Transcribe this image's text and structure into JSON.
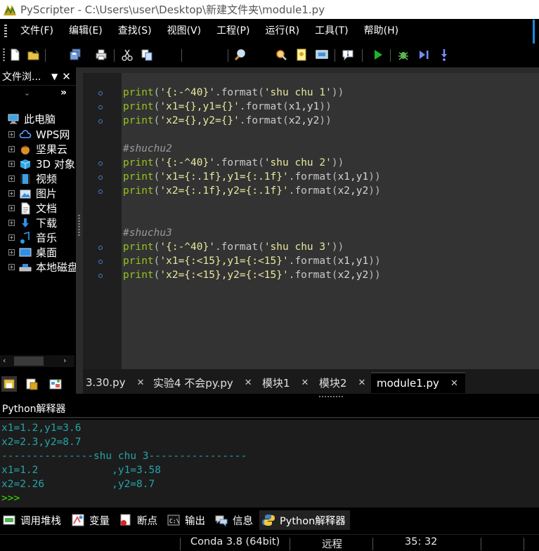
{
  "window": {
    "title": "PyScripter - C:\\Users\\user\\Desktop\\新建文件夹\\module1.py"
  },
  "menu": [
    "文件(F)",
    "编辑(E)",
    "查找(S)",
    "视图(V)",
    "工程(P)",
    "运行(R)",
    "工具(T)",
    "帮助(H)"
  ],
  "toolbar": {
    "icons": [
      "new-file-icon",
      "open-file-icon",
      "save-all-icon",
      "print-icon",
      "cut-icon",
      "copy-icon",
      "find-icon",
      "find-in-files-icon",
      "bookmark-icon",
      "screen-icon",
      "info-icon",
      "run-icon",
      "debug-icon",
      "step-icon",
      "step-into-icon"
    ]
  },
  "file_browser": {
    "title": "文件浏...",
    "pin": "▼",
    "close": "✕",
    "root": "此电脑",
    "items": [
      {
        "label": "WPS网",
        "icon": "cloud-icon"
      },
      {
        "label": "坚果云",
        "icon": "nut-icon"
      },
      {
        "label": "3D 对象",
        "icon": "cube-icon"
      },
      {
        "label": "视频",
        "icon": "film-icon"
      },
      {
        "label": "图片",
        "icon": "image-icon"
      },
      {
        "label": "文档",
        "icon": "document-icon"
      },
      {
        "label": "下载",
        "icon": "download-icon"
      },
      {
        "label": "音乐",
        "icon": "music-icon"
      },
      {
        "label": "桌面",
        "icon": "desktop-icon"
      },
      {
        "label": "本地磁盘",
        "icon": "drive-icon"
      }
    ]
  },
  "editor": {
    "lines": [
      {
        "bullet": true,
        "tokens": [
          [
            "fn",
            "print"
          ],
          [
            "punc",
            "("
          ],
          [
            "str",
            "'{:-^40}'"
          ],
          [
            "meth",
            ".format"
          ],
          [
            "punc",
            "("
          ],
          [
            "str",
            "'shu chu 1'"
          ],
          [
            "punc",
            "))"
          ]
        ]
      },
      {
        "bullet": true,
        "tokens": [
          [
            "fn",
            "print"
          ],
          [
            "punc",
            "("
          ],
          [
            "str",
            "'x1={},y1={}'"
          ],
          [
            "meth",
            ".format"
          ],
          [
            "punc",
            "("
          ],
          [
            "arg",
            "x1,y1"
          ],
          [
            "punc",
            "))"
          ]
        ]
      },
      {
        "bullet": true,
        "tokens": [
          [
            "fn",
            "print"
          ],
          [
            "punc",
            "("
          ],
          [
            "str",
            "'x2={},y2={}'"
          ],
          [
            "meth",
            ".format"
          ],
          [
            "punc",
            "("
          ],
          [
            "arg",
            "x2,y2"
          ],
          [
            "punc",
            "))"
          ]
        ]
      },
      {
        "bullet": false,
        "tokens": []
      },
      {
        "bullet": false,
        "tokens": [
          [
            "com",
            "#shuchu2"
          ]
        ]
      },
      {
        "bullet": true,
        "tokens": [
          [
            "fn",
            "print"
          ],
          [
            "punc",
            "("
          ],
          [
            "str",
            "'{:-^40}'"
          ],
          [
            "meth",
            ".format"
          ],
          [
            "punc",
            "("
          ],
          [
            "str",
            "'shu chu 2'"
          ],
          [
            "punc",
            "))"
          ]
        ]
      },
      {
        "bullet": true,
        "tokens": [
          [
            "fn",
            "print"
          ],
          [
            "punc",
            "("
          ],
          [
            "str",
            "'x1={:.1f},y1={:.1f}'"
          ],
          [
            "meth",
            ".format"
          ],
          [
            "punc",
            "("
          ],
          [
            "arg",
            "x1,y1"
          ],
          [
            "punc",
            "))"
          ]
        ]
      },
      {
        "bullet": true,
        "tokens": [
          [
            "fn",
            "print"
          ],
          [
            "punc",
            "("
          ],
          [
            "str",
            "'x2={:.1f},y2={:.1f}'"
          ],
          [
            "meth",
            ".format"
          ],
          [
            "punc",
            "("
          ],
          [
            "arg",
            "x2,y2"
          ],
          [
            "punc",
            "))"
          ]
        ]
      },
      {
        "bullet": false,
        "tokens": []
      },
      {
        "bullet": false,
        "tokens": []
      },
      {
        "bullet": false,
        "tokens": [
          [
            "com",
            "#shuchu3"
          ]
        ]
      },
      {
        "bullet": true,
        "tokens": [
          [
            "fn",
            "print"
          ],
          [
            "punc",
            "("
          ],
          [
            "str",
            "'{:-^40}'"
          ],
          [
            "meth",
            ".format"
          ],
          [
            "punc",
            "("
          ],
          [
            "str",
            "'shu chu 3'"
          ],
          [
            "punc",
            "))"
          ]
        ]
      },
      {
        "bullet": true,
        "tokens": [
          [
            "fn",
            "print"
          ],
          [
            "punc",
            "("
          ],
          [
            "str",
            "'x1={:<15},y1={:<15}'"
          ],
          [
            "meth",
            ".format"
          ],
          [
            "punc",
            "("
          ],
          [
            "arg",
            "x1,y1"
          ],
          [
            "punc",
            "))"
          ]
        ]
      },
      {
        "bullet": true,
        "tokens": [
          [
            "fn",
            "print"
          ],
          [
            "punc",
            "("
          ],
          [
            "str",
            "'x2={:<15},y2={:<15}'"
          ],
          [
            "meth",
            ".format"
          ],
          [
            "punc",
            "("
          ],
          [
            "arg",
            "x2,y2"
          ],
          [
            "punc",
            "))"
          ]
        ]
      }
    ]
  },
  "editor_tabs": [
    {
      "label": "3.30.py",
      "close": "✕",
      "active": false
    },
    {
      "label": "实验4 不会py.py",
      "close": "✕",
      "active": false
    },
    {
      "label": "模块1",
      "close": "✕",
      "active": false
    },
    {
      "label": "模块2",
      "close": "✕",
      "active": false
    },
    {
      "label": "module1.py",
      "close": "✕",
      "active": true
    }
  ],
  "interpreter": {
    "title": "Python解释器",
    "lines": [
      "x1=1.2,y1=3.6",
      "x2=2.3,y2=8.7",
      "---------------shu chu 3----------------",
      "x1=1.2            ,y1=3.58",
      "x2=2.26           ,y2=8.7",
      ">>>"
    ]
  },
  "bottom_tabs": [
    {
      "label": "调用堆栈",
      "icon": "call-stack-icon",
      "active": false
    },
    {
      "label": "变量",
      "icon": "variables-icon",
      "active": false
    },
    {
      "label": "断点",
      "icon": "breakpoints-icon",
      "active": false
    },
    {
      "label": "输出",
      "icon": "output-icon",
      "active": false
    },
    {
      "label": "信息",
      "icon": "messages-icon",
      "active": false
    },
    {
      "label": "Python解释器",
      "icon": "python-icon",
      "active": true
    }
  ],
  "status": {
    "interpreter": "Conda 3.8 (64bit)",
    "engine": "远程",
    "position": "35: 32"
  },
  "colors": {
    "function": "#98c21f",
    "string": "#e8e8a0",
    "output": "#25a3a8",
    "prompt": "#3fe000",
    "accent": "#1e8ad8"
  }
}
